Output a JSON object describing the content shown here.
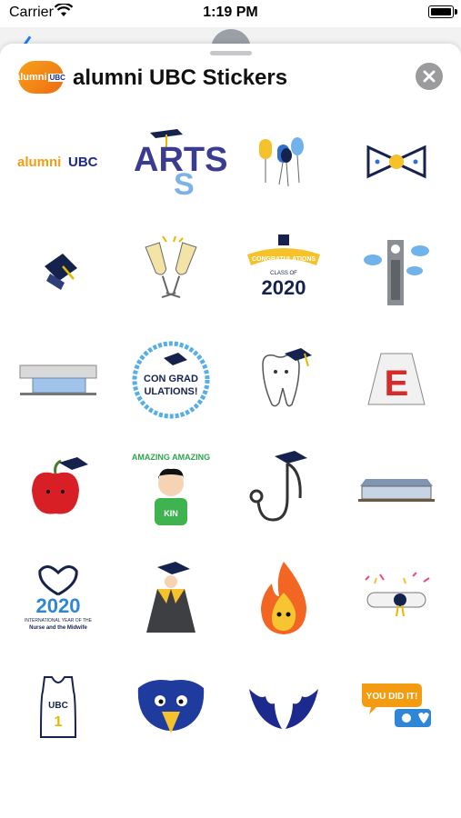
{
  "status_bar": {
    "carrier": "Carrier",
    "time": "1:19 PM"
  },
  "header": {
    "logo_text": "alumni",
    "logo_badge": "UBC",
    "title": "alumni UBC Stickers"
  },
  "stickers": [
    {
      "name": "alumni-ubc-wordmark",
      "text_a": "alumni",
      "text_b": "UBC"
    },
    {
      "name": "arts-letters",
      "text": "ARTS"
    },
    {
      "name": "balloons"
    },
    {
      "name": "bow-tie"
    },
    {
      "name": "graduation-cap"
    },
    {
      "name": "champagne-toast"
    },
    {
      "name": "congratulations-banner",
      "banner": "CONGRATULATIONS",
      "small": "CLASS OF",
      "year": "2020"
    },
    {
      "name": "clock-tower"
    },
    {
      "name": "campus-building"
    },
    {
      "name": "congratulations-badge",
      "line1": "CON GRAD",
      "line2": "ULATIONS!"
    },
    {
      "name": "tooth-with-cap"
    },
    {
      "name": "e-sign",
      "letter": "E"
    },
    {
      "name": "apple-with-cap"
    },
    {
      "name": "amazing-kid",
      "caption": "AMAZING AMAZING",
      "shirt": "KIN"
    },
    {
      "name": "stethoscope"
    },
    {
      "name": "building-exterior"
    },
    {
      "name": "nurse-2020-heart",
      "year": "2020",
      "line1": "INTERNATIONAL YEAR OF THE",
      "line2": "Nurse and the Midwife"
    },
    {
      "name": "graduation-gown"
    },
    {
      "name": "fire-mascot"
    },
    {
      "name": "diploma-scroll"
    },
    {
      "name": "ubc-jersey",
      "text": "UBC",
      "number": "1"
    },
    {
      "name": "thunderbird-mascot"
    },
    {
      "name": "wings"
    },
    {
      "name": "you-did-it-bubbles",
      "text": "YOU DID IT!"
    }
  ],
  "colors": {
    "ubc_blue": "#1b2a8c",
    "orange": "#f39c12",
    "close_gray": "#9b9b9e"
  }
}
